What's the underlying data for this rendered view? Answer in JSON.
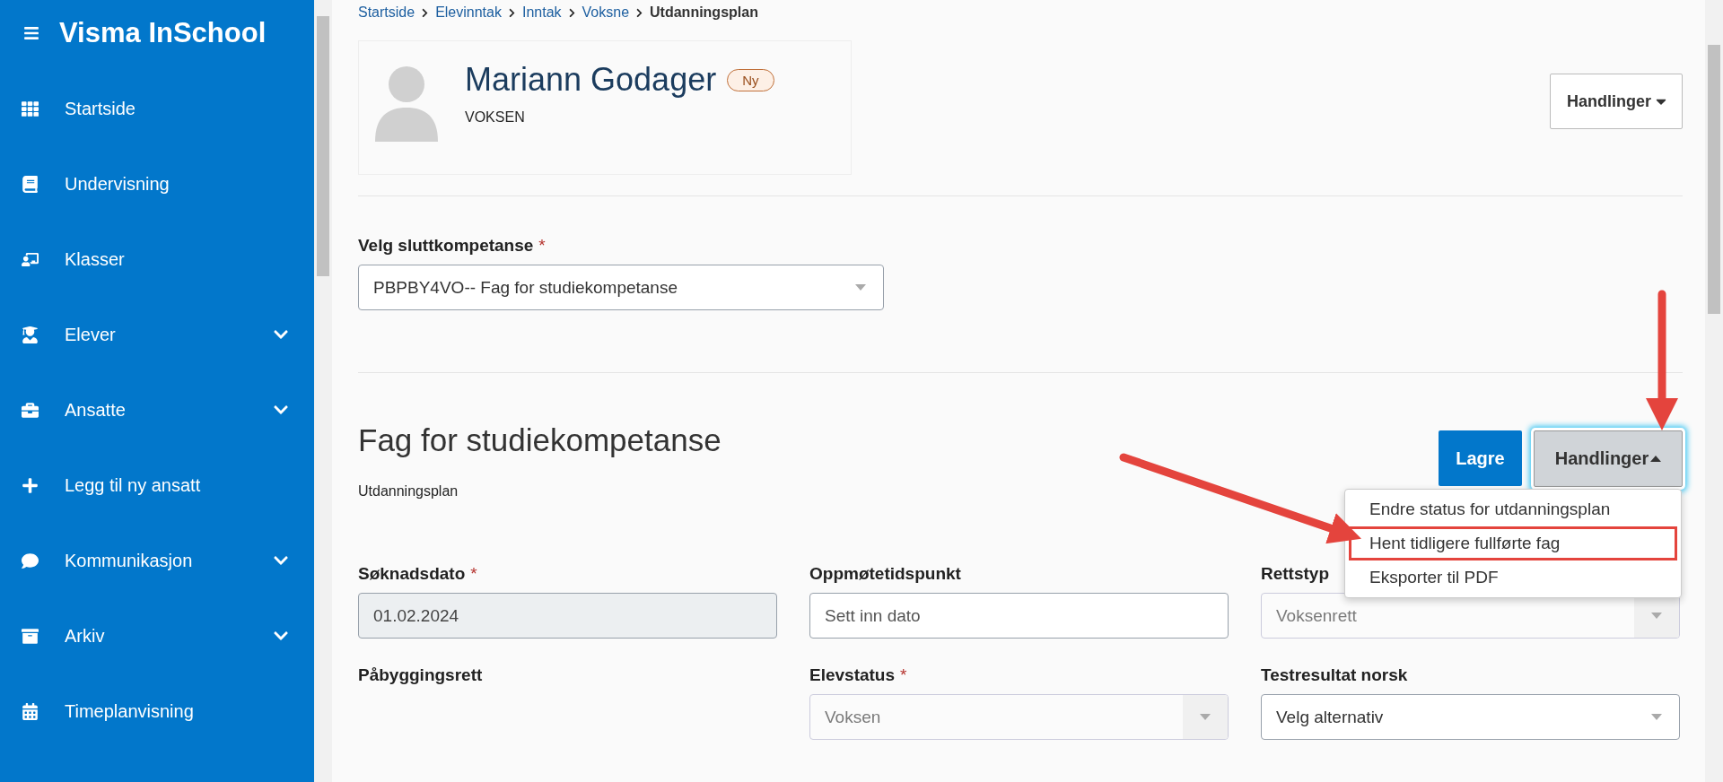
{
  "app": {
    "title": "Visma InSchool"
  },
  "sidebar": {
    "items": [
      {
        "label": "Startside",
        "expandable": false
      },
      {
        "label": "Undervisning",
        "expandable": false
      },
      {
        "label": "Klasser",
        "expandable": false
      },
      {
        "label": "Elever",
        "expandable": true
      },
      {
        "label": "Ansatte",
        "expandable": true
      },
      {
        "label": "Legg til ny ansatt",
        "expandable": false
      },
      {
        "label": "Kommunikasjon",
        "expandable": true
      },
      {
        "label": "Arkiv",
        "expandable": true
      },
      {
        "label": "Timeplanvisning",
        "expandable": false
      }
    ]
  },
  "breadcrumb": [
    {
      "label": "Startside",
      "current": false
    },
    {
      "label": "Elevinntak",
      "current": false
    },
    {
      "label": "Inntak",
      "current": false
    },
    {
      "label": "Voksne",
      "current": false
    },
    {
      "label": "Utdanningsplan",
      "current": true
    }
  ],
  "profile": {
    "name": "Mariann Godager",
    "badge": "Ny",
    "subtitle": "VOKSEN",
    "actions_button": "Handlinger"
  },
  "competence": {
    "label": "Velg sluttkompetanse",
    "required_mark": "*",
    "value": "PBPBY4VO-- Fag for studiekompetanse"
  },
  "section": {
    "title": "Fag for studiekompetanse",
    "subtitle": "Utdanningsplan",
    "save_button": "Lagre",
    "actions_button": "Handlinger",
    "expanded": true,
    "menu": [
      {
        "label": "Endre status for utdanningsplan",
        "highlighted": false
      },
      {
        "label": "Hent tidligere fullførte fag",
        "highlighted": true
      },
      {
        "label": "Eksporter til PDF",
        "highlighted": false
      }
    ]
  },
  "fields": [
    {
      "kind": "input",
      "label": "Søknadsdato",
      "required_mark": "*",
      "value": "01.02.2024",
      "disabled": true
    },
    {
      "kind": "input",
      "label": "Oppmøtetidspunkt",
      "placeholder": "Sett inn dato",
      "disabled": false
    },
    {
      "kind": "select",
      "label": "Rettstyp",
      "value": "Voksenrett",
      "disabled": true
    },
    {
      "kind": "none",
      "label": "Påbyggingsrett"
    },
    {
      "kind": "select",
      "label": "Elevstatus",
      "required_mark": "*",
      "value": "Voksen",
      "disabled": true
    },
    {
      "kind": "select",
      "label": "Testresultat norsk",
      "placeholder": "Velg alternativ",
      "disabled": false
    }
  ]
}
